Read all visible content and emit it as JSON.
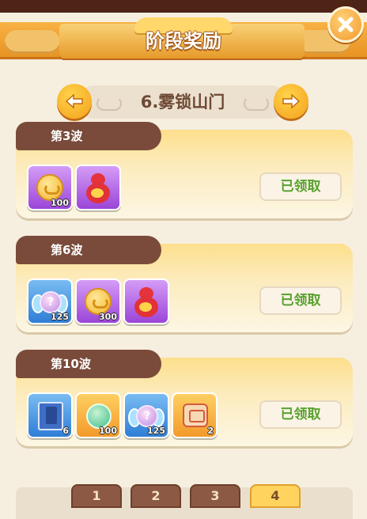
{
  "header": {
    "title": "阶段奖励"
  },
  "stage": {
    "name": "6.雾锁山门"
  },
  "waves": [
    {
      "label": "第3波",
      "claim_label": "已领取",
      "items": [
        {
          "icon": "coin-icon",
          "color": "purple",
          "qty": "100"
        },
        {
          "icon": "gourd-icon",
          "color": "purple",
          "qty": ""
        }
      ]
    },
    {
      "label": "第6波",
      "claim_label": "已领取",
      "items": [
        {
          "icon": "winged-orb-icon",
          "color": "blue",
          "qty": "125"
        },
        {
          "icon": "coin-icon",
          "color": "purple",
          "qty": "300"
        },
        {
          "icon": "gourd-icon",
          "color": "purple",
          "qty": ""
        }
      ]
    },
    {
      "label": "第10波",
      "claim_label": "已领取",
      "items": [
        {
          "icon": "book-icon",
          "color": "blue",
          "qty": "6"
        },
        {
          "icon": "jade-icon",
          "color": "orange",
          "qty": "100"
        },
        {
          "icon": "winged-orb-icon",
          "color": "blue",
          "qty": "125"
        },
        {
          "icon": "scroll-icon",
          "color": "orange",
          "qty": "2"
        }
      ]
    }
  ],
  "orb_symbol": "?",
  "page_tabs": [
    "1",
    "2",
    "3",
    "4"
  ],
  "active_page_tab": 3
}
